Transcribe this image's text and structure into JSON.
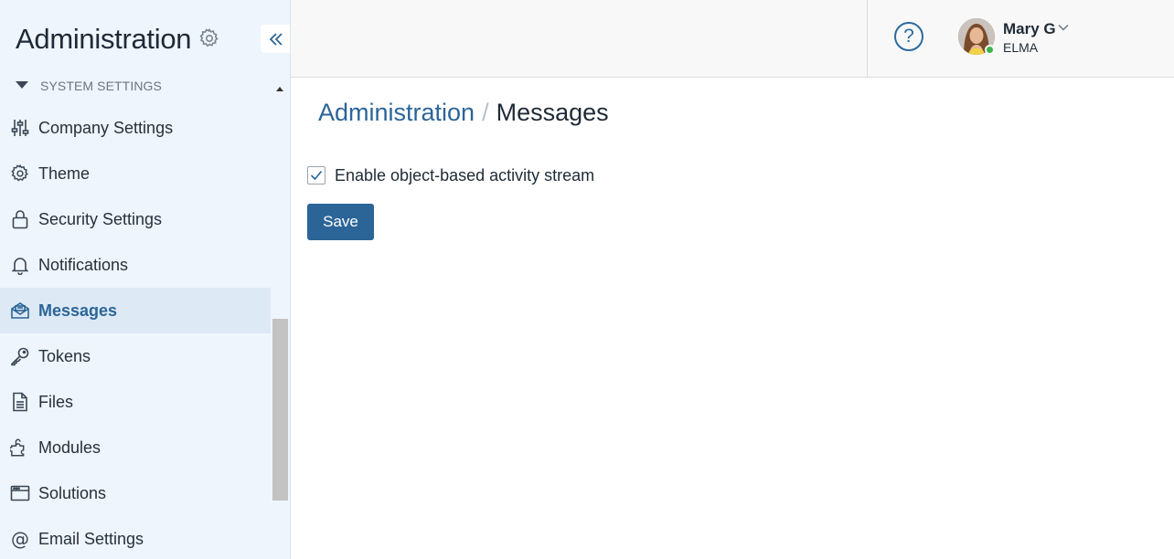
{
  "sidebar": {
    "title": "Administration",
    "title_icon": "gear-icon",
    "collapse_icon": "double-chevron-left-icon",
    "section_label": "SYSTEM SETTINGS",
    "items": [
      {
        "label": "Company Settings",
        "icon": "sliders-icon",
        "active": false
      },
      {
        "label": "Theme",
        "icon": "gear-icon",
        "active": false
      },
      {
        "label": "Security Settings",
        "icon": "lock-icon",
        "active": false
      },
      {
        "label": "Notifications",
        "icon": "bell-icon",
        "active": false
      },
      {
        "label": "Messages",
        "icon": "envelope-icon",
        "active": true
      },
      {
        "label": "Tokens",
        "icon": "key-icon",
        "active": false
      },
      {
        "label": "Files",
        "icon": "file-icon",
        "active": false
      },
      {
        "label": "Modules",
        "icon": "puzzle-icon",
        "active": false
      },
      {
        "label": "Solutions",
        "icon": "window-icon",
        "active": false
      },
      {
        "label": "Email Settings",
        "icon": "at-icon",
        "active": false
      }
    ]
  },
  "header": {
    "help_icon": "question-circle-icon",
    "help_glyph": "?",
    "user": {
      "name": "Mary G",
      "company": "ELMA",
      "status": "online"
    }
  },
  "main": {
    "breadcrumb": {
      "root": "Administration",
      "separator": "/",
      "current": "Messages"
    },
    "checkbox": {
      "label": "Enable object-based activity stream",
      "checked": true
    },
    "save_label": "Save"
  },
  "colors": {
    "accent": "#2b6598",
    "sidebar_bg": "#eef5fc",
    "active_bg": "#dde9f5",
    "online": "#3bb44a"
  }
}
